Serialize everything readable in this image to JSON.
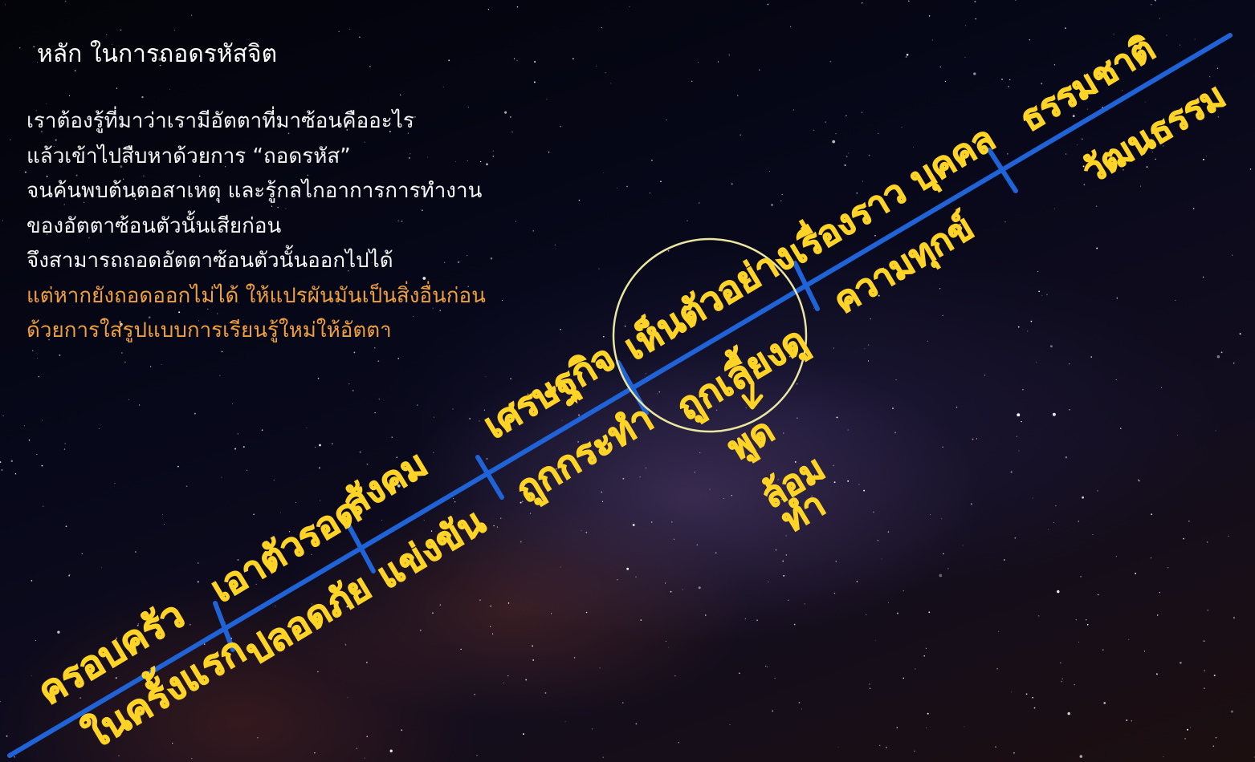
{
  "slide": {
    "title": "หลัก ในการถอดรหัสจิต",
    "paragraph_white": [
      "เราต้องรู้ที่มาว่าเรามีอัตตาที่มาซ้อนคืออะไร",
      "แล้วเข้าไปสืบหาด้วยการ “ถอดรหัส”",
      "จนค้นพบต้นตอสาเหตุ และรู้กลไกอาการการทำงาน",
      "ของอัตตาซ้อนตัวนั้นเสียก่อน",
      "จึงสามารถถอดอัตตาซ้อนตัวนั้นออกไปได้"
    ],
    "paragraph_orange": [
      "แต่หากยังถอดออกไม่ได้ ให้แปรผันมันเป็นสิ่งอื่นก่อน",
      "ด้วยการใส่รูปแบบการเรียนรู้ใหม่ให้อัตตา"
    ]
  },
  "colors": {
    "timeline": "#1f63d6",
    "handwriting": "#ffd426",
    "circle": "#e8e6a0",
    "orange_text": "#f0a040"
  },
  "annotations": {
    "above": [
      "ครอบครัว",
      "เอาตัวรอด",
      "สังคม",
      "เศรษฐกิจ",
      "เห็นตัวอย่าง",
      "เรื่องราว บุคคล",
      "ธรรมชาติ"
    ],
    "below": [
      "ในครั้งแรก",
      "ปลอดภัย",
      "แข่งขัน",
      "ถูกกระทำ",
      "ถูกเลี้ยงดู",
      "ความทุกข์",
      "วัฒนธรรม"
    ],
    "arrow_targets": [
      "พูด",
      "ล้อม",
      "ทำ"
    ]
  }
}
